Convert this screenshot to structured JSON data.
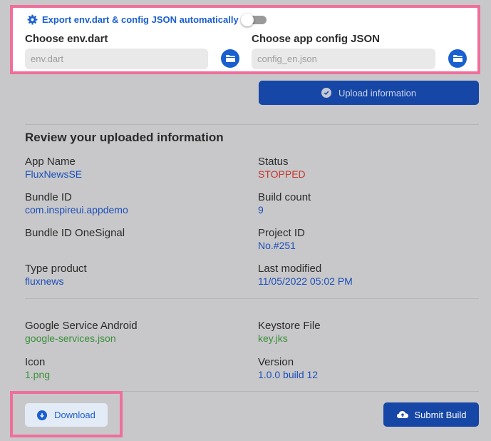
{
  "config": {
    "export_label": "Export env.dart & config JSON automatically",
    "export_toggle_on": false,
    "env_label": "Choose env.dart",
    "env_placeholder": "env.dart",
    "config_label": "Choose app config JSON",
    "config_placeholder": "config_en.json"
  },
  "upload_label": "Upload information",
  "review": {
    "title": "Review your uploaded information",
    "left": [
      {
        "label": "App Name",
        "value": "FluxNewsSE"
      },
      {
        "label": "Bundle ID",
        "value": "com.inspireui.appdemo"
      },
      {
        "label": "Bundle ID OneSignal",
        "value": ""
      },
      {
        "label": "Type product",
        "value": "fluxnews"
      }
    ],
    "right": [
      {
        "label": "Status",
        "value": "STOPPED"
      },
      {
        "label": "Build count",
        "value": "9"
      },
      {
        "label": "Project ID",
        "value": "No.#251"
      },
      {
        "label": "Last modified",
        "value": "11/05/2022 05:02 PM"
      }
    ],
    "files_left": [
      {
        "label": "Google Service Android",
        "value": "google-services.json"
      },
      {
        "label": "Icon",
        "value": "1.png"
      }
    ],
    "files_right": [
      {
        "label": "Keystore File",
        "value": "key.jks"
      },
      {
        "label": "Version",
        "value": "1.0.0 build 12"
      }
    ]
  },
  "download_label": "Download",
  "submit_label": "Submit Build",
  "colors": {
    "accent": "#1a5fd0",
    "primary_button": "#1646a6",
    "highlight": "#ef6f9b",
    "status_stopped": "#c6382d",
    "file_green": "#3a8f3a"
  },
  "icons": [
    "gear-icon",
    "folder-icon",
    "check-circle-icon",
    "download-icon",
    "cloud-upload-icon"
  ]
}
